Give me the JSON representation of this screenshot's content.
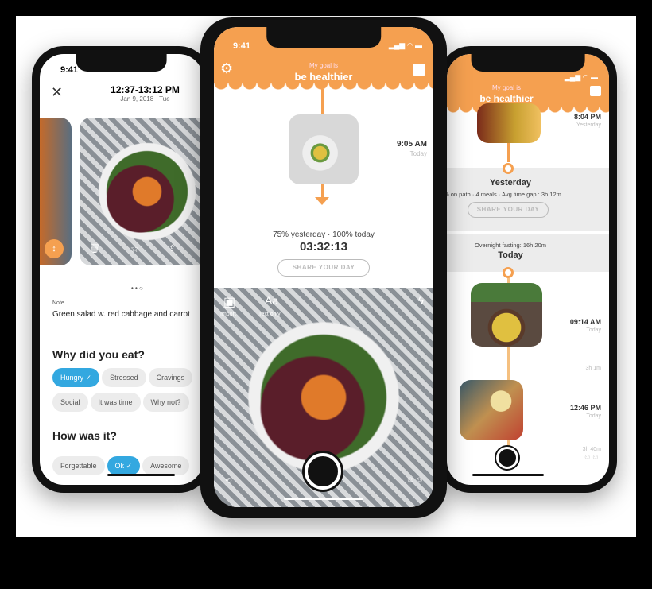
{
  "left_phone": {
    "status_time": "9:41",
    "time_range": "12:37-13:12 PM",
    "date": "Jan 9, 2018 · Tue",
    "note_label": "Note",
    "note_text": "Green salad w. red cabbage and carrot",
    "why_title": "Why did you eat?",
    "why_options": [
      "Hungry ✓",
      "Stressed",
      "Cravings",
      "Social",
      "It was time",
      "Why not?"
    ],
    "how_title": "How was it?",
    "how_options": [
      "Forgettable",
      "Ok ✓",
      "Awesome"
    ]
  },
  "center_phone": {
    "status_time": "9:41",
    "goal_label": "My goal is",
    "goal_text": "be healthier",
    "meal_time": "9:05 AM",
    "meal_day": "Today",
    "progress_text": "75% yesterday · 100% today",
    "timer": "03:32:13",
    "share_label": "SHARE YOUR DAY",
    "import_label": "Import",
    "text_only_label": "Text only",
    "text_only_glyph": "Aa"
  },
  "right_phone": {
    "goal_label": "My goal is",
    "goal_text": "be healthier",
    "prev_time": "8:04 PM",
    "prev_day": "Yesterday",
    "yesterday_title": "Yesterday",
    "yesterday_stats": "% on path · 4 meals · Avg time gap : 3h 12m",
    "share_label": "SHARE YOUR DAY",
    "fasting": "Overnight fasting: 16h 20m",
    "today_title": "Today",
    "meals": [
      {
        "time": "09:14 AM",
        "day": "Today"
      },
      {
        "time": "12:46 PM",
        "day": "Today"
      }
    ],
    "gap1": "3h 1m",
    "gap2": "3h 40m"
  },
  "colors": {
    "accent": "#f5a050",
    "chip_selected": "#33a8e0"
  }
}
